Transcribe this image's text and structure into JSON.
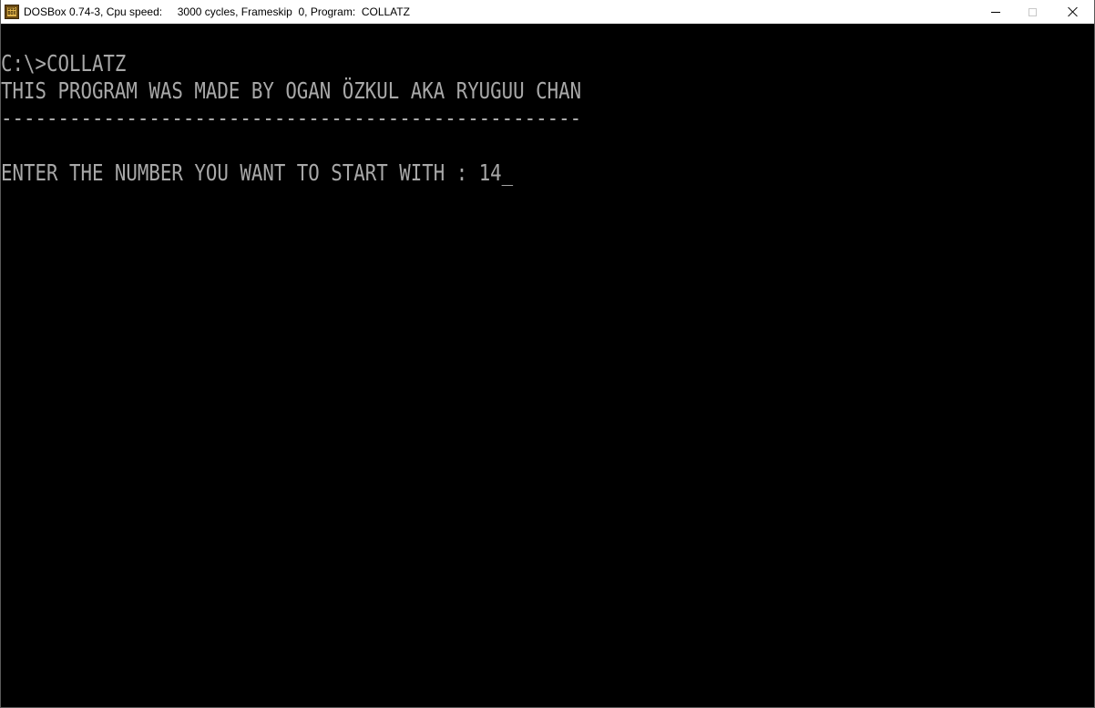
{
  "window": {
    "title": "DOSBox 0.74-3, Cpu speed:     3000 cycles, Frameskip  0, Program:  COLLATZ",
    "icon": "dosbox-icon",
    "icon_text": "DOS BOX",
    "controls": {
      "minimize": "minimize-icon",
      "maximize": "maximize-icon",
      "close": "close-icon"
    }
  },
  "console": {
    "command_line": "C:\\>COLLATZ",
    "credit_line": "THIS PROGRAM WAS MADE BY OGAN ÖZKUL AKA RYUGUU CHAN",
    "separator": "---------------------------------------------------",
    "prompt": "ENTER THE NUMBER YOU WANT TO START WITH : ",
    "input_value": "14",
    "cursor": "_"
  },
  "colors": {
    "screen_background": "#000000",
    "text": "#a8a8a8",
    "titlebar": "#ffffff"
  }
}
